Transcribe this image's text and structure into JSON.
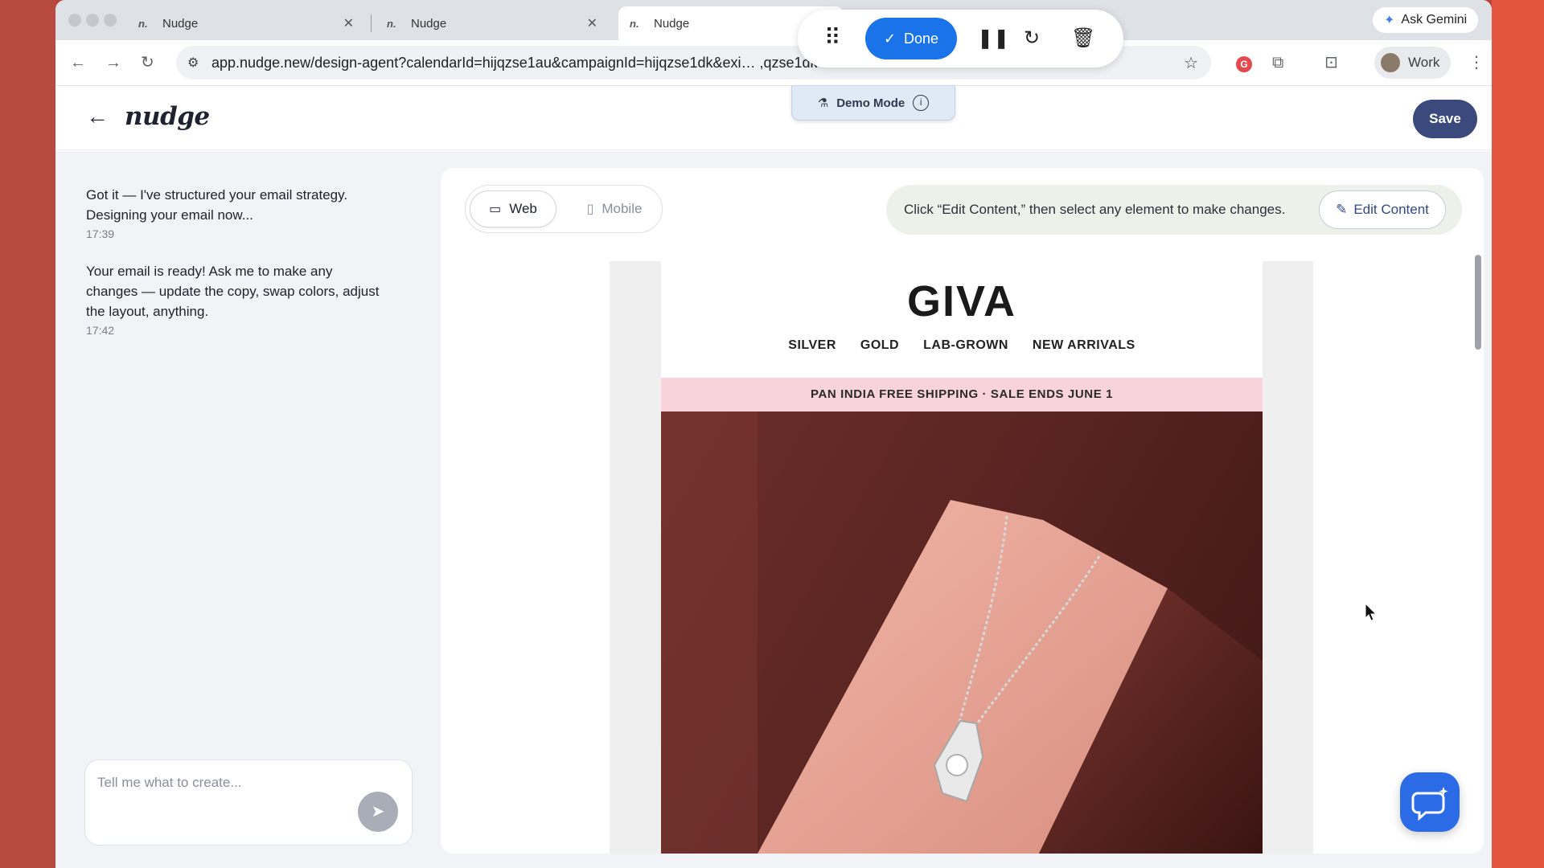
{
  "browser": {
    "tabs": [
      {
        "favicon": "n.",
        "title": "Nudge"
      },
      {
        "favicon": "n.",
        "title": "Nudge"
      },
      {
        "favicon": "n.",
        "title": "Nudge"
      }
    ],
    "url": "app.nudge.new/design-agent?calendarId=hijqzse1au&campaignId=hijqzse1dk&exi…                                    ,qzse1dk\"%2C\"ca...",
    "ask_gemini": "Ask Gemini",
    "profile": "Work",
    "extension_badge": "G"
  },
  "recorder": {
    "done_label": "Done"
  },
  "demo_mode": {
    "label": "Demo Mode"
  },
  "app": {
    "logo": "nudge",
    "save_label": "Save"
  },
  "chat": {
    "messages": [
      {
        "text": "Got it — I've structured your email strategy. Designing your email now...",
        "time": "17:39"
      },
      {
        "text": "Your email is ready! Ask me to make any changes — update the copy, swap colors, adjust the layout, anything.",
        "time": "17:42"
      }
    ],
    "placeholder": "Tell me what to create..."
  },
  "preview": {
    "view_web": "Web",
    "view_mobile": "Mobile",
    "hint": "Click “Edit Content,” then select any element to make changes.",
    "edit_content": "Edit Content"
  },
  "email": {
    "brand": "GIVA",
    "nav": [
      "SILVER",
      "GOLD",
      "LAB-GROWN",
      "NEW ARRIVALS"
    ],
    "banner": "PAN INDIA FREE SHIPPING · SALE ENDS JUNE 1"
  },
  "icons": {
    "back": "arrow-left-icon",
    "send": "send-icon",
    "help": "chat-bubble-icon"
  },
  "colors": {
    "primary": "#3b4a7d",
    "done_blue": "#1a73e8",
    "banner_pink": "#f8d3dc",
    "help_blue": "#2b6be6"
  }
}
